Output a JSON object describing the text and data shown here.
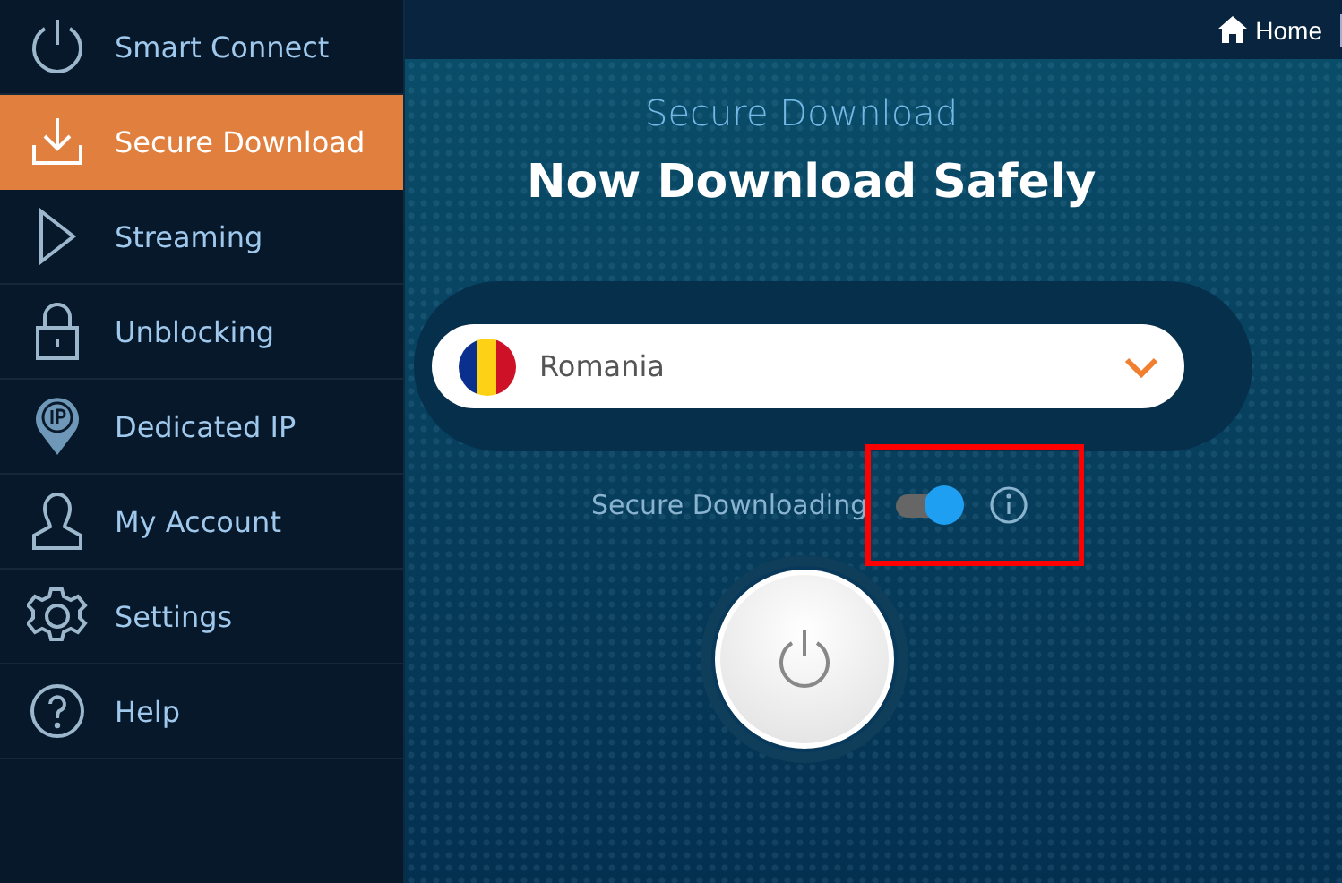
{
  "sidebar": {
    "items": [
      {
        "label": "Smart Connect",
        "selected": false
      },
      {
        "label": "Secure Download",
        "selected": true
      },
      {
        "label": "Streaming",
        "selected": false
      },
      {
        "label": "Unblocking",
        "selected": false
      },
      {
        "label": "Dedicated IP",
        "selected": false
      },
      {
        "label": "My Account",
        "selected": false
      },
      {
        "label": "Settings",
        "selected": false
      },
      {
        "label": "Help",
        "selected": false
      }
    ]
  },
  "top_bar": {
    "home": "Home"
  },
  "subtitle": "Secure Download",
  "heading": "Now Download Safely",
  "country_select": {
    "value": "Romania"
  },
  "toggle": {
    "label": "Secure Downloading",
    "on": true,
    "highlighted": true
  }
}
